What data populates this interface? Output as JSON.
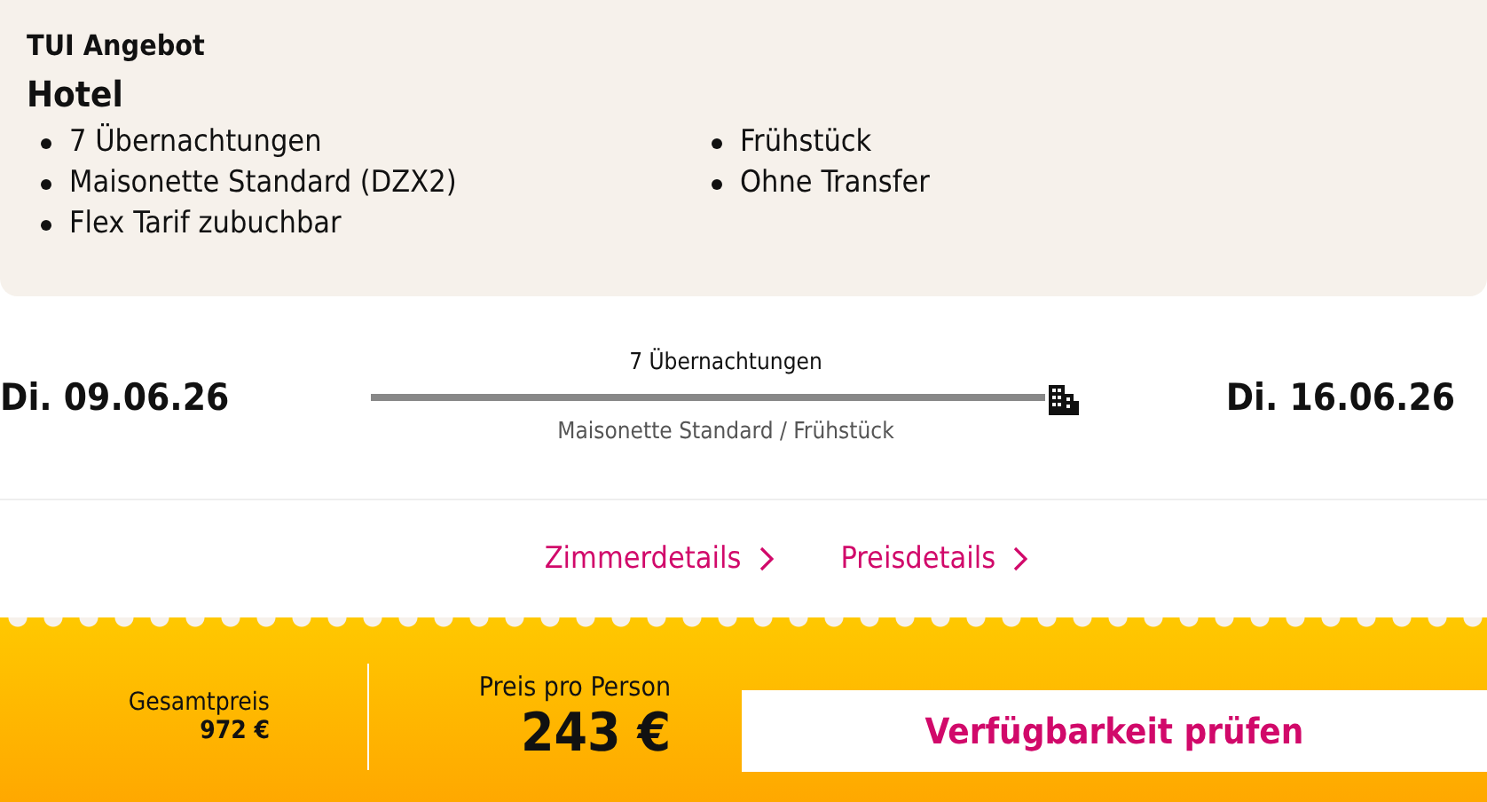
{
  "offer": {
    "label": "TUI Angebot",
    "title": "Hotel",
    "features_left": [
      "7 Übernachtungen",
      "Maisonette Standard (DZX2)",
      "Flex Tarif zubuchbar"
    ],
    "features_right": [
      "Frühstück",
      "Ohne Transfer"
    ]
  },
  "stay": {
    "start_date": "Di. 09.06.26",
    "nights": "7 Übernachtungen",
    "room": "Maisonette Standard / Frühstück",
    "end_date": "Di. 16.06.26"
  },
  "links": [
    "Zimmerdetails",
    "Preisdetails"
  ],
  "price": {
    "total_label": "Gesamtpreis",
    "total": "972 €",
    "per_person_label": "Preis pro Person",
    "per_person": "243 €",
    "button": "Verfügbarkeit prüfen"
  }
}
